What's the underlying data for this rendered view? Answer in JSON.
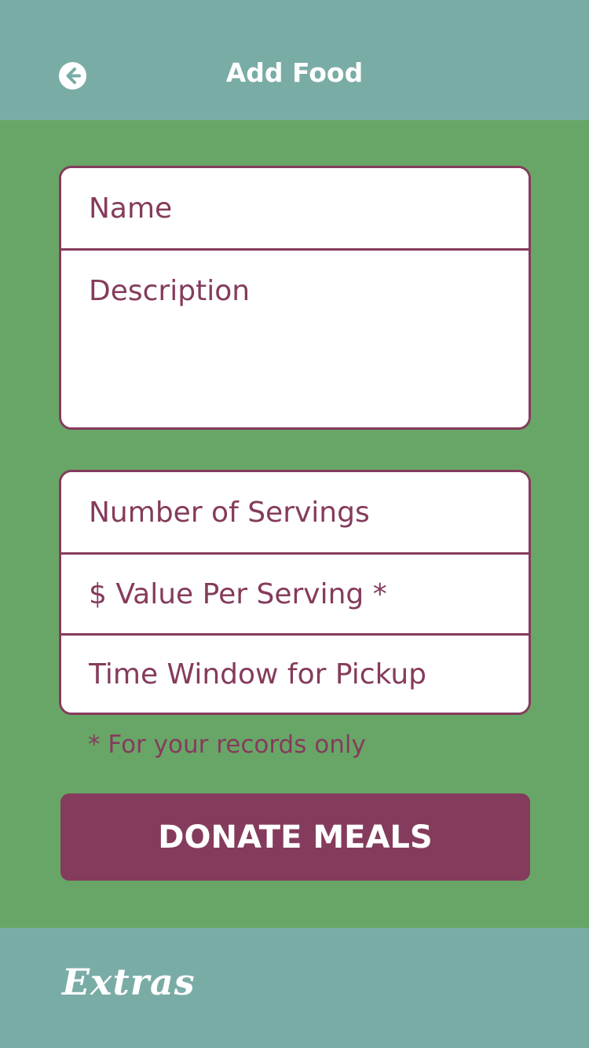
{
  "header": {
    "title": "Add Food",
    "back_icon": "arrow-left-circle-icon"
  },
  "form": {
    "name_placeholder": "Name",
    "description_placeholder": "Description",
    "servings_placeholder": "Number of Servings",
    "value_placeholder": "$ Value Per Serving *",
    "time_placeholder": "Time Window for Pickup",
    "note": "* For your records only"
  },
  "actions": {
    "donate_label": "DONATE MEALS"
  },
  "footer": {
    "logo_text": "Extras"
  },
  "colors": {
    "header_bg": "#7aaca6",
    "content_bg": "#68a667",
    "accent": "#853b5c",
    "white": "#ffffff"
  }
}
